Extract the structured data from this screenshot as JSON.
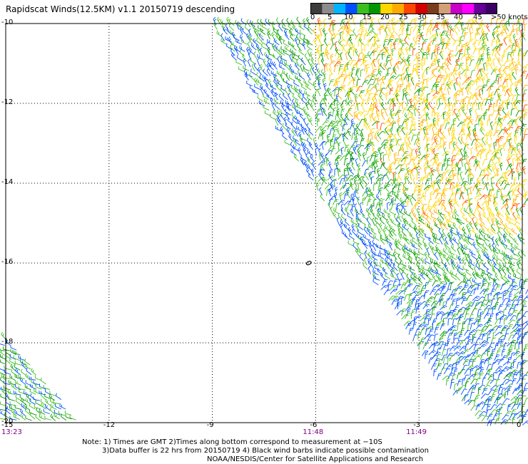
{
  "title": "Rapidscat Winds(12.5KM) v1.1 20150719 descending",
  "colorbar": {
    "colors": [
      "#3c3c3c",
      "#8c8c8c",
      "#00b4ff",
      "#0050ff",
      "#3cbe1e",
      "#009600",
      "#ffd700",
      "#ffaa00",
      "#ff4600",
      "#d20000",
      "#7a3a1e",
      "#d2a078",
      "#c800c8",
      "#ff00ff",
      "#640096",
      "#3c0064"
    ],
    "labels": [
      "0",
      "5",
      "10",
      "15",
      "20",
      "25",
      "30",
      "35",
      "40",
      "45",
      ">50 knots"
    ]
  },
  "map": {
    "lat_ticks": [
      "-10",
      "-12",
      "-14",
      "-16",
      "-18",
      "-20"
    ],
    "lon_ticks": [
      "-15",
      "-12",
      "-9",
      "-6",
      "-3",
      "0"
    ],
    "lat_range": [
      -20,
      -10
    ],
    "lon_range": [
      -15,
      0
    ],
    "grid": "dotted",
    "times": [
      {
        "label": "13:23",
        "lon": -15
      },
      {
        "label": "11:48",
        "lon": -6
      },
      {
        "label": "11:49",
        "lon": -3
      }
    ],
    "feature_marker": {
      "symbol": "o",
      "lat": -16,
      "lon": -6.2
    }
  },
  "wind_speed_regions": [
    {
      "region": "west swath edge",
      "knots": "10-20",
      "colors": [
        "#0050ff",
        "#3cbe1e"
      ]
    },
    {
      "region": "north-east interior",
      "knots": "20-30",
      "colors": [
        "#ffd700",
        "#ffaa00",
        "#ff4600"
      ]
    },
    {
      "region": "south-east interior",
      "knots": "10-15",
      "colors": [
        "#0050ff",
        "#3cbe1e"
      ]
    }
  ],
  "notes": {
    "line1": "Note: 1) Times are GMT 2)Times along bottom correspond to measurement at −10S",
    "line2": "3)Data buffer is 22 hrs from 20150719 4) Black wind barbs indicate possible contamination",
    "line3": "NOAA/NESDIS/Center for Satellite Applications and Research"
  }
}
